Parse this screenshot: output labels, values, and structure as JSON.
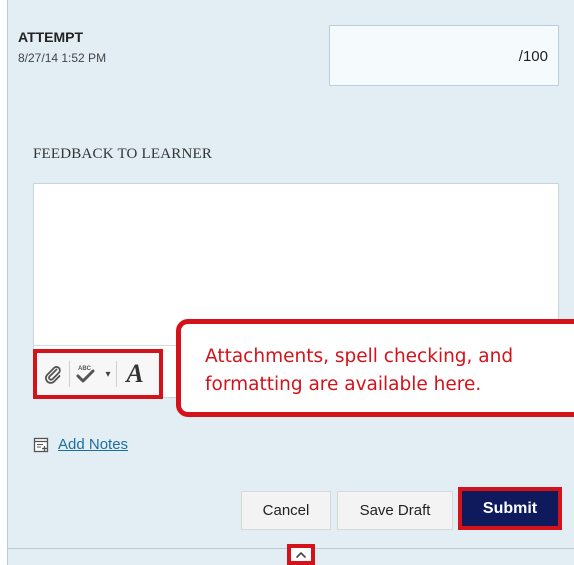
{
  "attempt": {
    "title": "ATTEMPT",
    "date": "8/27/14 1:52 PM",
    "grade_suffix": "/100"
  },
  "feedback": {
    "label": "FEEDBACK TO LEARNER",
    "editor_value": ""
  },
  "toolbar": {
    "icons": [
      "paperclip-icon",
      "spell-check-icon",
      "caret-down-icon",
      "format-text-icon"
    ],
    "format_glyph": "A"
  },
  "callout": {
    "line1": "Attachments, spell checking, and",
    "line2": "formatting are available here."
  },
  "notes": {
    "link": "Add Notes",
    "icon": "notes-icon"
  },
  "buttons": {
    "cancel": "Cancel",
    "save_draft": "Save Draft",
    "submit": "Submit"
  },
  "colors": {
    "panel_bg": "#e2eef4",
    "highlight": "#d4121a",
    "submit_bg": "#0f1a5c",
    "link": "#1d6fa0"
  }
}
